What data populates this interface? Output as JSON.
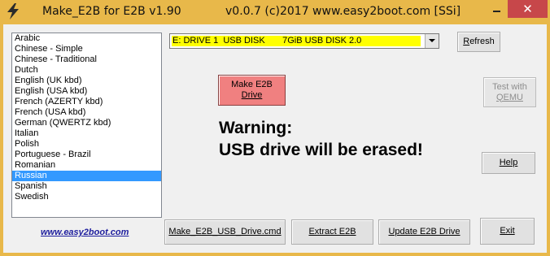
{
  "titlebar": {
    "title": "Make_E2B for E2B v1.90",
    "version": "v0.0.7  (c)2017 www.easy2boot.com [SSi]"
  },
  "languages": {
    "items": [
      "Arabic",
      "Chinese - Simple",
      "Chinese - Traditional",
      "Dutch",
      "English  (UK kbd)",
      "English  (USA kbd)",
      "French  (AZERTY kbd)",
      "French  (USA kbd)",
      "German  (QWERTZ kbd)",
      "Italian",
      "Polish",
      "Portuguese - Brazil",
      "Romanian",
      "Russian",
      "Spanish",
      "Swedish"
    ],
    "selected": "Russian"
  },
  "drive_select": {
    "value": "E: DRIVE 1  USB DISK       7GiB USB DISK 2.0"
  },
  "buttons": {
    "refresh": "Refresh",
    "make_drive_line1": "Make E2B",
    "make_drive_line2": "Drive",
    "qemu_line1": "Test with",
    "qemu_line2": "QEMU",
    "help": "Help",
    "cmd": "Make_E2B_USB_Drive.cmd",
    "extract": "Extract E2B",
    "update": "Update E2B Drive",
    "exit": "Exit"
  },
  "warning": {
    "line1": "Warning:",
    "line2": "USB drive will be erased!"
  },
  "website": "www.easy2boot.com",
  "colors": {
    "titlebar": "#e8b84a",
    "close": "#c7474a",
    "make_drive": "#f08080",
    "selection": "#3399ff",
    "drive_highlight": "#ffff00"
  }
}
